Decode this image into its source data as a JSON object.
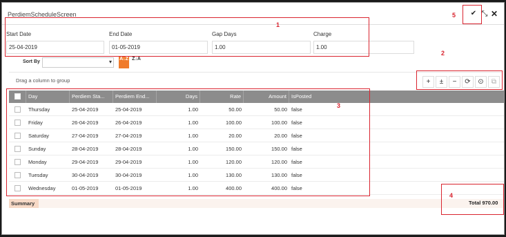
{
  "window": {
    "title": "PerdiemScheduleScreen",
    "check_icon": "✔",
    "expand_icon": "⤡",
    "close_icon": "✕"
  },
  "form": {
    "start_date": {
      "label": "Start Date",
      "value": "25-04-2019"
    },
    "end_date": {
      "label": "End Date",
      "value": "01-05-2019"
    },
    "gap_days": {
      "label": "Gap Days",
      "value": "1.00"
    },
    "charge": {
      "label": "Charge",
      "value": "1.00"
    }
  },
  "sort": {
    "label": "Sort By",
    "value": "",
    "caret": "▾",
    "asc_icon": "A↓Z",
    "desc_icon": "Z↓A"
  },
  "grid": {
    "group_text": "Drag a column to group",
    "toolbar": {
      "add": "+",
      "add_sub": "±",
      "remove": "−",
      "refresh": "⟳",
      "reset": "⊙",
      "export": "⧉"
    },
    "columns": [
      "Day",
      "Perdiem Sta...",
      "Perdiem End...",
      "Days",
      "Rate",
      "Amount",
      "IsPosted"
    ],
    "rows": [
      [
        "Thursday",
        "25-04-2019",
        "25-04-2019",
        "1.00",
        "50.00",
        "50.00",
        "false"
      ],
      [
        "Friday",
        "26-04-2019",
        "26-04-2019",
        "1.00",
        "100.00",
        "100.00",
        "false"
      ],
      [
        "Saturday",
        "27-04-2019",
        "27-04-2019",
        "1.00",
        "20.00",
        "20.00",
        "false"
      ],
      [
        "Sunday",
        "28-04-2019",
        "28-04-2019",
        "1.00",
        "150.00",
        "150.00",
        "false"
      ],
      [
        "Monday",
        "29-04-2019",
        "29-04-2019",
        "1.00",
        "120.00",
        "120.00",
        "false"
      ],
      [
        "Tuesday",
        "30-04-2019",
        "30-04-2019",
        "1.00",
        "130.00",
        "130.00",
        "false"
      ],
      [
        "Wednesday",
        "01-05-2019",
        "01-05-2019",
        "1.00",
        "400.00",
        "400.00",
        "false"
      ]
    ]
  },
  "summary": {
    "label": "Summary",
    "total": "Total 970.00"
  },
  "annotations": [
    "1",
    "2",
    "3",
    "4",
    "5"
  ],
  "colors": {
    "accent": "#f07b2b",
    "annotation": "#d9232e",
    "header": "#8c8c8c"
  }
}
